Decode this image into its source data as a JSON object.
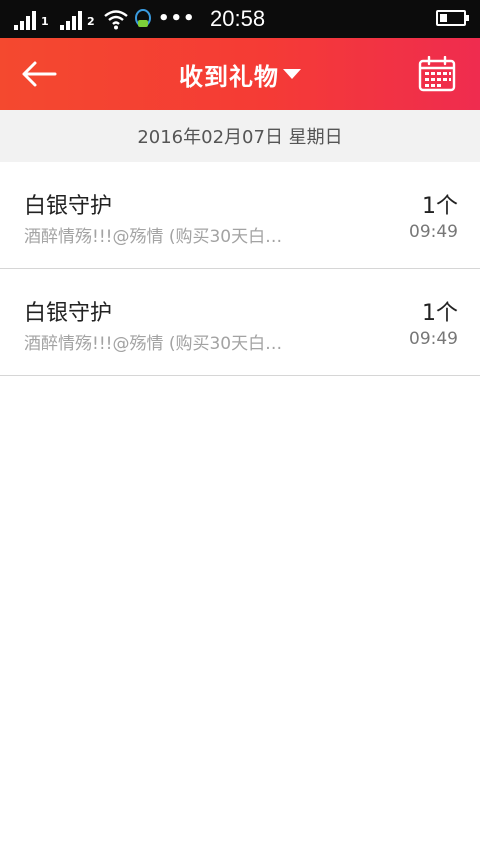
{
  "status_bar": {
    "sim1_label": "1",
    "sim2_label": "2",
    "overflow_dots": "•••",
    "time": "20:58",
    "battery_level": 0.3
  },
  "header": {
    "title": "收到礼物",
    "back_icon": "arrow-left-icon",
    "calendar_icon": "calendar-icon",
    "background_colors": [
      "#f4492f",
      "#ef2c4f"
    ]
  },
  "date_bar": {
    "text": "2016年02月07日 星期日"
  },
  "gifts": [
    {
      "name": "白银守护",
      "detail": "酒醉情殇!!!@殇情 (购买30天白…",
      "count": "1个",
      "time": "09:49"
    },
    {
      "name": "白银守护",
      "detail": "酒醉情殇!!!@殇情 (购买30天白…",
      "count": "1个",
      "time": "09:49"
    }
  ]
}
